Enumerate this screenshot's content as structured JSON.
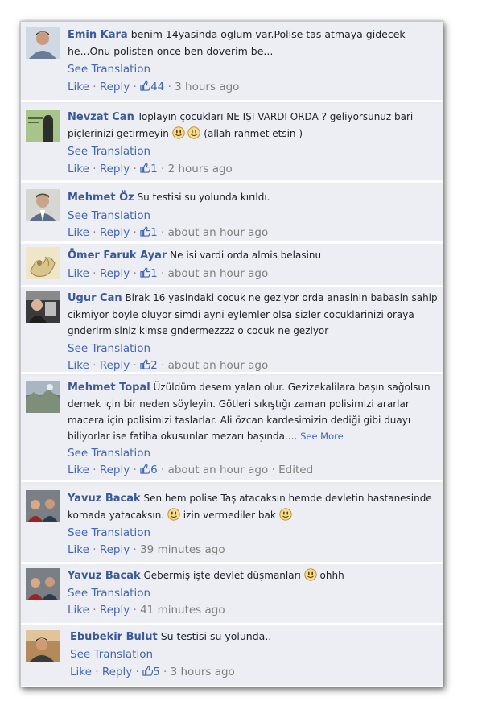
{
  "comments": [
    {
      "author": "Emin Kara",
      "text": "benim 14yasinda oglum var.Polise tas atmaya gidecek he...Onu polisten once ben doverim be...",
      "see_translation": "See Translation",
      "like": "Like",
      "reply": "Reply",
      "likes": "44",
      "time": "3 hours ago"
    },
    {
      "author": "Nevzat Can",
      "text_a": "Toplayın çocukları NE IŞI VARDI ORDA ? geliyorsunuz bari piçlerinizi getirmeyin",
      "text_b": "(allah rahmet etsin )",
      "see_translation": "See Translation",
      "like": "Like",
      "reply": "Reply",
      "likes": "1",
      "time": "2 hours ago"
    },
    {
      "author": "Mehmet Öz",
      "text": "Su testisi su yolunda kırıldı.",
      "see_translation": "See Translation",
      "like": "Like",
      "reply": "Reply",
      "likes": "1",
      "time": "about an hour ago"
    },
    {
      "author": "Ömer Faruk Ayar",
      "text": "Ne isi vardi orda almis belasinu",
      "like": "Like",
      "reply": "Reply",
      "likes": "1",
      "time": "about an hour ago"
    },
    {
      "author": "Ugur Can",
      "text": "Birak 16 yasindaki cocuk ne geziyor orda anasinin babasin sahip cikmiyor boyle oluyor simdi ayni eylemler olsa sizler cocuklarinizi oraya gnderirmisiniz kimse gndermezzzz o cocuk ne geziyor",
      "see_translation": "See Translation",
      "like": "Like",
      "reply": "Reply",
      "likes": "2",
      "time": "about an hour ago"
    },
    {
      "author": "Mehmet Topal",
      "text": "Üzüldüm desem yalan olur. Gezizekalilara başın sağolsun demek için bir neden söyleyin. Götleri sıkıştığı zaman polisimizi ararlar macera için polisimizi taslarlar. Ali özcan kardesimizin dediği gibi duayı biliyorlar ise fatiha okusunlar mezarı başında....",
      "see_more": "See More",
      "see_translation": "See Translation",
      "like": "Like",
      "reply": "Reply",
      "likes": "6",
      "time": "about an hour ago",
      "edited": "Edited"
    },
    {
      "author": "Yavuz Bacak",
      "text_a": "Sen hem polise Taş atacaksın hemde devletin hastanesinde komada yatacaksın.",
      "text_b": "izin vermediler bak",
      "see_translation": "See Translation",
      "like": "Like",
      "reply": "Reply",
      "time": "39 minutes ago"
    },
    {
      "author": "Yavuz Bacak",
      "text_a": "Gebermiş işte devlet düşmanları",
      "text_b": "ohhh",
      "see_translation": "See Translation",
      "like": "Like",
      "reply": "Reply",
      "time": "41 minutes ago"
    },
    {
      "author": "Ebubekir Bulut",
      "text": "Su testisi su yolunda..",
      "see_translation": "See Translation",
      "like": "Like",
      "reply": "Reply",
      "likes": "5",
      "time": "3 hours ago"
    }
  ],
  "separator": "·"
}
